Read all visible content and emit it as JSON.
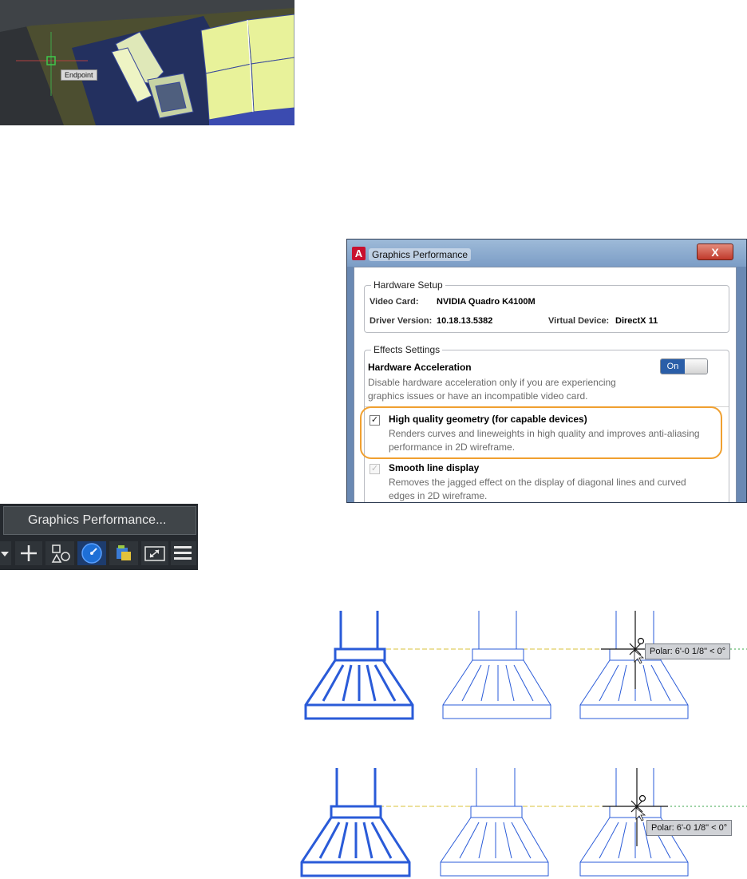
{
  "viewport": {
    "snap_tooltip": "Endpoint",
    "colors": {
      "background": "#3b3f44",
      "slab": "#4c4e30",
      "face_yellow": "#e8f29a",
      "face_light": "#eef4c4",
      "edge_blue": "#3a4a9a"
    }
  },
  "dialog": {
    "title": "Graphics Performance",
    "app_icon": "A",
    "close_glyph": "X",
    "hardware_setup": {
      "legend": "Hardware Setup",
      "video_card_label": "Video Card:",
      "video_card_value": "NVIDIA Quadro K4100M",
      "driver_version_label": "Driver Version:",
      "driver_version_value": "10.18.13.5382",
      "virtual_device_label": "Virtual Device:",
      "virtual_device_value": "DirectX 11"
    },
    "effects_settings": {
      "legend": "Effects Settings",
      "hardware_acceleration": {
        "title": "Hardware Acceleration",
        "toggle_label": "On",
        "desc_line1": "Disable hardware acceleration only if you are experiencing",
        "desc_line2": "graphics issues or have an incompatible video card."
      },
      "high_quality_geometry": {
        "checked": true,
        "title": "High quality geometry (for capable devices)",
        "desc_line1": "Renders curves and lineweights in high quality and improves anti-aliasing",
        "desc_line2": "performance in 2D wireframe."
      },
      "smooth_line_display": {
        "checked": true,
        "disabled": true,
        "title": "Smooth line display",
        "desc_line1": "Removes the jagged effect on the display of diagonal lines and curved",
        "desc_line2": "edges in 2D wireframe."
      }
    },
    "colors": {
      "highlight": "#f0a030",
      "toggle_on": "#2a5ea8"
    }
  },
  "statusbar": {
    "tooltip": "Graphics Performance...",
    "buttons": [
      {
        "icon": "dropdown-arrow-icon"
      },
      {
        "icon": "plus-icon"
      },
      {
        "icon": "isolate-objects-icon"
      },
      {
        "icon": "graphics-performance-icon",
        "active": true
      },
      {
        "icon": "clean-screen-icon"
      },
      {
        "icon": "fullscreen-icon"
      },
      {
        "icon": "menu-icon"
      }
    ]
  },
  "drawings": {
    "polar_tooltip_top": "Polar: 6'-0 1/8\" < 0°",
    "polar_tooltip_bottom": "Polar: 6'-0 1/8\" < 0°",
    "colors": {
      "footing_blue": "#2a5bd8",
      "track_yellow": "#d8c238",
      "track_green": "#3aa64a"
    }
  }
}
